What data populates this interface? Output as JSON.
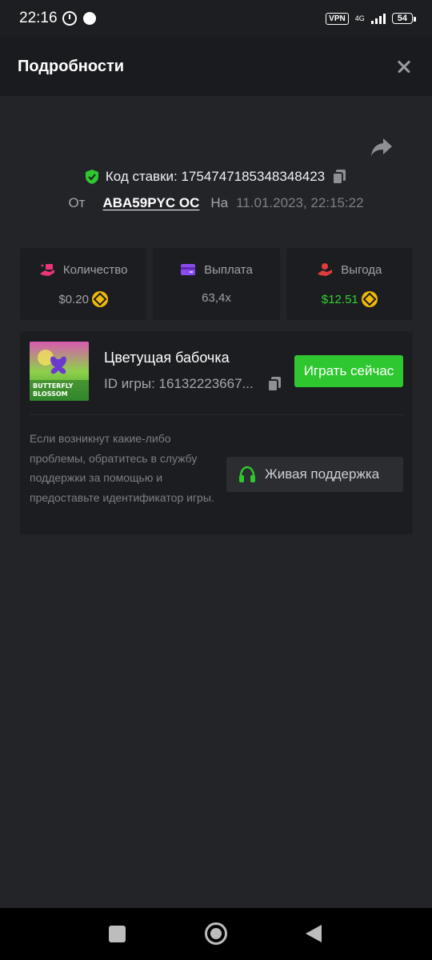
{
  "status_bar": {
    "time": "22:16",
    "vpn": "VPN",
    "network": "4G",
    "battery": "54"
  },
  "header": {
    "title": "Подробности"
  },
  "bet": {
    "code_label": "Код ставки: 1754747185348348423",
    "from_label": "От",
    "user": "ABA59PYC OC",
    "on_label": "На",
    "datetime": "11.01.2023, 22:15:22"
  },
  "stats": [
    {
      "label": "Количество",
      "value": "$0.20",
      "icon": "wallet-hand-icon",
      "color": "#e8357a"
    },
    {
      "label": "Выплата",
      "value": "63,4x",
      "icon": "card-icon",
      "color": "#8a4cf0"
    },
    {
      "label": "Выгода",
      "value": "$12.51",
      "icon": "money-hand-icon",
      "color": "#e23b3b"
    }
  ],
  "game": {
    "name": "Цветущая бабочка",
    "id": "ID игры: 16132223667...",
    "play_label": "Играть сейчас",
    "thumb_text_1": "BUTTERFLY",
    "thumb_text_2": "BLOSSOM",
    "help_text": "Если возникнут какие-либо проблемы, обратитесь в службу поддержки за помощью и предоставьте идентификатор игры.",
    "support_label": "Живая поддержка"
  },
  "colors": {
    "accent_green": "#2fc72f",
    "background": "#232428",
    "card": "#1c1d20"
  }
}
